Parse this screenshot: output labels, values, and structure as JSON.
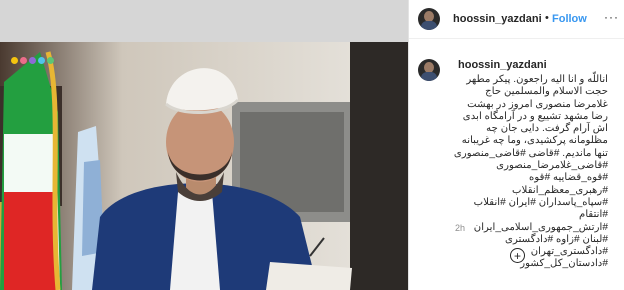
{
  "post": {
    "author": "hoossin_yazdani",
    "follow_label": "Follow",
    "more_icon": "ellipsis-icon",
    "caption": "اناللّه و انا الیه راجعون. پیکر مطهر حجت الاسلام والمسلمین حاج غلامرضا منصوری امروز در بهشت رضا مشهد تشییع و در آرامگاه ابدی اش آرام گرفت. دایی جان چه مظلومانه پرکشیدی، وما چه غریبانه تنها ماندیم. #قاضی #قاضی_منصوری #قاضی_غلامرضا_منصوری #قوه_قضاییه #قوه #رهبری_معظم_انقلاب #سپاه_پاسداران #ایران #انقلاب #انتقام #ارتش_جمهوری_اسلامی_ایران #لبنان #زاوه #دادگستری #دادگستری_تهران #دادستان_کل_کشور",
    "timestamp": "2h",
    "add_comment_icon": "plus-circle-icon"
  },
  "colors": {
    "follow": "#3897f0",
    "flag_green": "#239f40",
    "flag_red": "#da0000",
    "robe": "#1e3a78"
  }
}
